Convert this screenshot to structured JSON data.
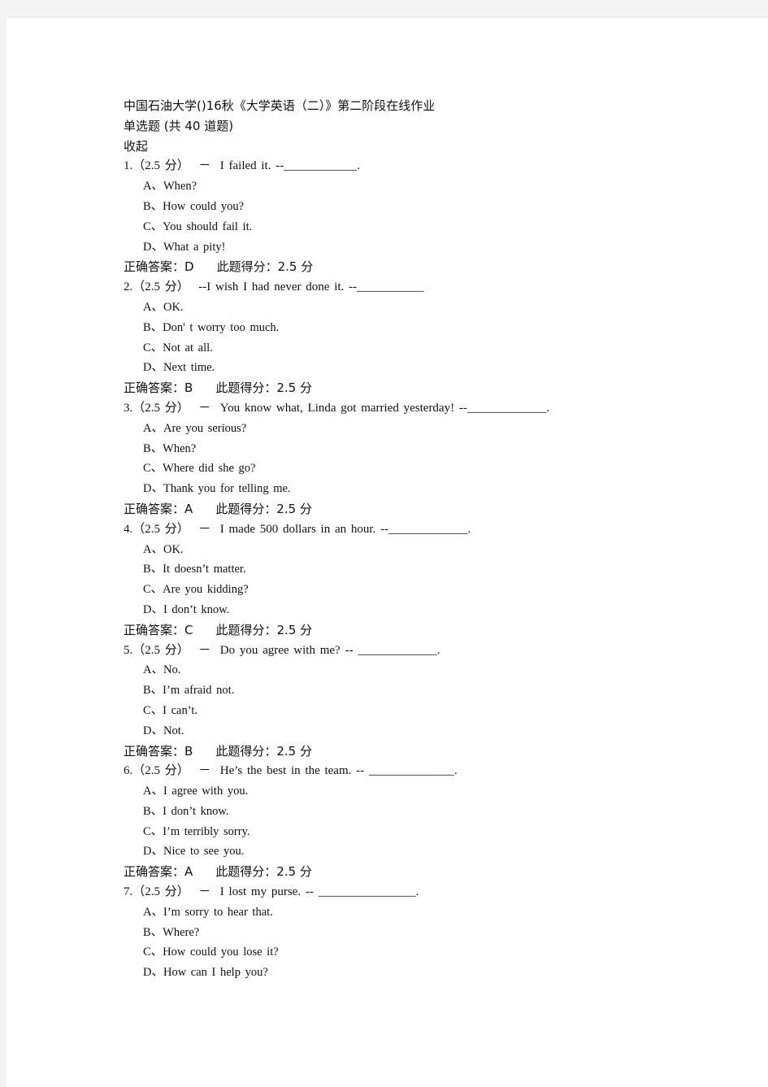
{
  "document": {
    "title": "中国石油大学()16秋《大学英语（二）》第二阶段在线作业",
    "section": "单选题 (共 40 道题)",
    "collapse_label": "收起",
    "answer_label": "正确答案：",
    "score_label": "此题得分：",
    "questions": [
      {
        "prompt": "1.（2.5 分）  －  I failed it. --____________.",
        "options": [
          "A、When?",
          "B、How could you?",
          "C、You should fail it.",
          "D、What a pity!"
        ],
        "answer": "D",
        "score": "2.5 分"
      },
      {
        "prompt": "2.（2.5 分）  --I wish I had never done it. --___________",
        "options": [
          "A、OK.",
          "B、Don' t worry too much.",
          "C、Not at all.",
          "D、Next time."
        ],
        "answer": "B",
        "score": "2.5 分"
      },
      {
        "prompt": "3.（2.5 分）  －  You know what, Linda got married yesterday! --_____________.",
        "options": [
          "A、Are you serious?",
          "B、When?",
          "C、Where did she go?",
          "D、Thank you for telling me."
        ],
        "answer": "A",
        "score": "2.5 分"
      },
      {
        "prompt": "4.（2.5 分）  －  I made 500 dollars in an hour. --_____________.",
        "options": [
          "A、OK.",
          "B、It doesn’t matter.",
          "C、Are you kidding?",
          "D、I don’t know."
        ],
        "answer": "C",
        "score": "2.5 分"
      },
      {
        "prompt": "5.（2.5 分）  －  Do you agree with me? -- _____________.",
        "options": [
          "A、No.",
          "B、I’m afraid not.",
          "C、I can’t.",
          "D、Not."
        ],
        "answer": "B",
        "score": "2.5 分"
      },
      {
        "prompt": "6.（2.5 分）  －  He’s the best in the team. -- ______________.",
        "options": [
          "A、I agree with you.",
          "B、I don’t know.",
          "C、I’m terribly sorry.",
          "D、Nice to see you."
        ],
        "answer": "A",
        "score": "2.5 分"
      },
      {
        "prompt": "7.（2.5 分）  －  I lost my purse. -- ________________.",
        "options": [
          "A、I’m sorry to hear that.",
          "B、Where?",
          "C、How could you lose it?",
          "D、How can I help you?"
        ],
        "answer": null,
        "score": null
      }
    ]
  }
}
